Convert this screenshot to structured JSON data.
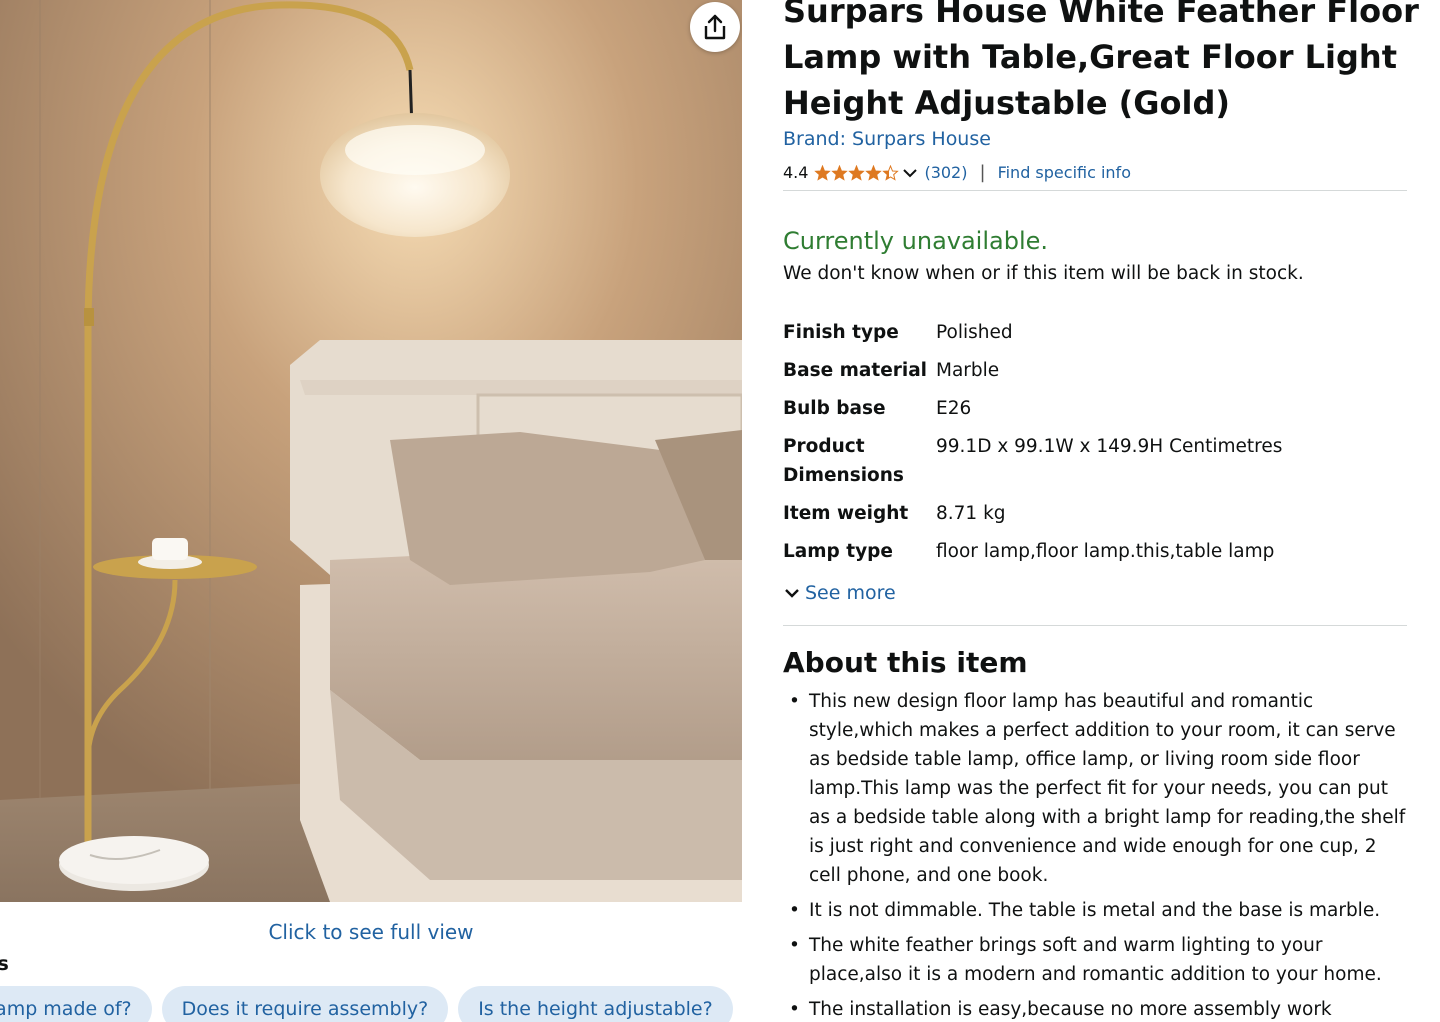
{
  "product": {
    "title": "Surpars House White Feather Floor Lamp with Table,Great Floor Light Height Adjustable (Gold)",
    "brand": "Brand: Surpars House",
    "rating": "4.4",
    "rating_stars": 4.4,
    "review_count": "(302)",
    "separator": "|",
    "find_info": "Find specific info"
  },
  "availability": {
    "status": "Currently unavailable.",
    "detail": "We don't know when or if this item will be back in stock."
  },
  "specs": [
    {
      "key": "Finish type",
      "value": "Polished"
    },
    {
      "key": "Base material",
      "value": "Marble"
    },
    {
      "key": "Bulb base",
      "value": "E26"
    },
    {
      "key": "Product Dimensions",
      "value": "99.1D x 99.1W x 149.9H Centimetres"
    },
    {
      "key": "Item weight",
      "value": "8.71 kg"
    },
    {
      "key": "Lamp type",
      "value": "floor lamp,floor lamp.this,table lamp"
    }
  ],
  "see_more": "See more",
  "about": {
    "heading": "About this item",
    "bullets": [
      "This new design floor lamp has beautiful and romantic style,which makes a perfect addition to your room, it can serve as bedside table lamp, office lamp, or living room side floor lamp.This lamp was the perfect fit for your needs, you can put as a bedside table along with a bright lamp for reading,the shelf is just right and convenience and wide enough for one cup, 2 cell phone, and one book.",
      "It is not dimmable. The table is metal and the base is marble.",
      "The white feather brings soft and warm lighting to your place,also it is a modern and romantic addition to your home.",
      "The installation is easy,because no more assembly work"
    ]
  },
  "gallery": {
    "full_view": "Click to see full view",
    "ask_heading": "us",
    "questions": [
      "he lamp made of?",
      "Does it require assembly?",
      "Is the height adjustable?"
    ]
  },
  "colors": {
    "link": "#2162a1",
    "unavailable": "#2f7d32",
    "star": "#de7921",
    "chip_bg": "#dde9f5"
  },
  "icons": {
    "share": "share-icon",
    "chevron": "chevron-down-icon",
    "star": "star-icon"
  }
}
